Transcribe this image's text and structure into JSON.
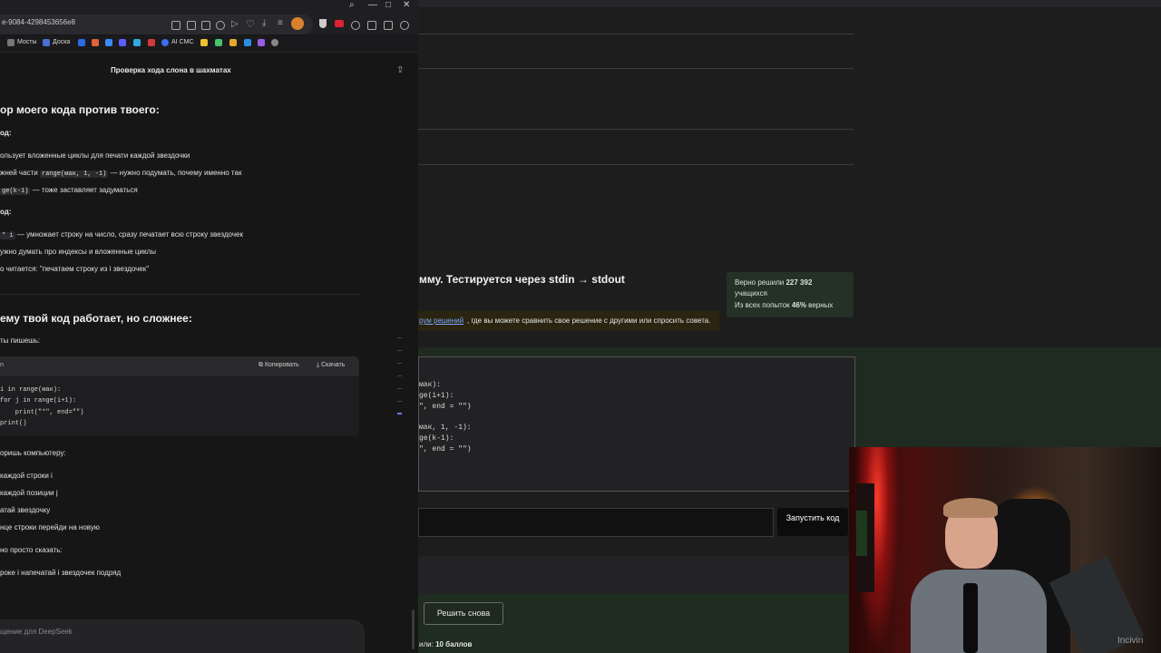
{
  "browser": {
    "url": "e-9084-4298453656e8",
    "bookmarks": [
      "Мосты",
      "Доска",
      "AI CMC"
    ],
    "chat_title": "Проверка хода слона в шахматах",
    "input_placeholder": "щение для DeepSeek"
  },
  "chat": {
    "heading1": "ор моего кода против твоего:",
    "sub1": "од:",
    "list1": [
      "ользует вложенные циклы для печати каждой звездочки",
      "жней части",
      "— нужно подумать, почему именно так",
      "— тоже заставляет задуматься"
    ],
    "code_a": "range(мак, 1, -1)",
    "code_b": "ge(k-1)",
    "sub2": "од:",
    "code_c": "* i",
    "list2": [
      "— умножает строку на число, сразу печатает всю строку звездочек",
      "ужно думать про индексы и вложенные циклы",
      "о читается: \"печатаем строку из i звездочек\""
    ],
    "heading2": "ему твой код работает, но сложнее:",
    "sub3": "ты пишешь:",
    "copy_label": "Копировать",
    "download_label": "Скачать",
    "code_lines": [
      "i in range(мак):",
      "for j in range(i+1):",
      "    print(\"*\", end=\"\")",
      "print()"
    ],
    "sub4": "оришь компьютеру:",
    "list3": [
      "каждой строки i",
      "каждой позиции j",
      "атай звездочку",
      "нце строки перейди на новую"
    ],
    "sub5": "но просто сказать:",
    "final": "роке i напечатай i звездочек подряд"
  },
  "site": {
    "task_title": "мму. Тестируется через stdin → stdout",
    "notice_link": "рум решений",
    "notice_text": ", где вы можете сравнить свое решение с другими или спросить совета.",
    "stats": {
      "solved_prefix": "Верно решили",
      "solved_count": "227 392",
      "solved_suffix": "учащихся",
      "attempts_prefix": "Из всех попыток",
      "attempts_pct": "46%",
      "attempts_suffix": "верных"
    },
    "editor_lines": [
      "мак):",
      "ge(i+1):",
      "\", end = \"\")",
      "",
      "мак, 1, -1):",
      "ge(k-1):",
      "\", end = \"\")"
    ],
    "run_button": "Запустить код",
    "retry_button": "Решить снова",
    "score_prefix": "или:",
    "score_value": "10 баллов"
  },
  "webcam": {
    "watermark": "Incivin"
  }
}
